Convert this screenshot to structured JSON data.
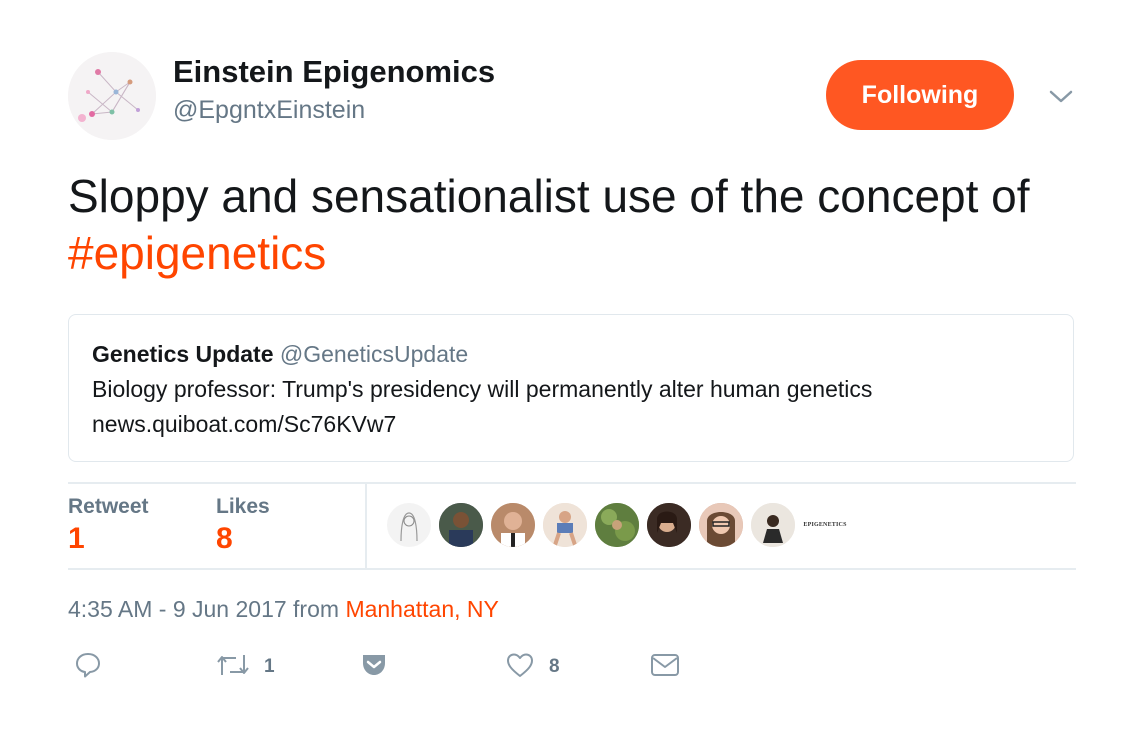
{
  "colors": {
    "accent": "#ff4500",
    "follow_button": "#ff5722",
    "muted_text": "#657786"
  },
  "author": {
    "display_name": "Einstein Epigenomics",
    "handle": "@EpgntxEinstein",
    "avatar_icon": "network-diagram-avatar"
  },
  "follow_button": {
    "label": "Following"
  },
  "caret_icon": "chevron-down-icon",
  "tweet": {
    "text_before": "Sloppy and sensationalist use of the concept of ",
    "hashtag": "#epigenetics"
  },
  "quoted_tweet": {
    "name": "Genetics Update",
    "handle": "@GeneticsUpdate",
    "text": "Biology professor: Trump's presidency will permanently alter human genetics",
    "link": "news.quiboat.com/Sc76KVw7"
  },
  "stats": {
    "retweet_label": "Retweet",
    "retweet_count": "1",
    "likes_label": "Likes",
    "likes_count": "8"
  },
  "likers_logo_text": "EPIGENETICS",
  "timestamp": {
    "text": "4:35 AM - 9 Jun 2017 from ",
    "location": "Manhattan, NY"
  },
  "actions": {
    "reply_icon": "reply-icon",
    "retweet_icon": "retweet-icon",
    "retweet_count": "1",
    "save_icon": "pocket-icon",
    "like_icon": "heart-icon",
    "like_count": "8",
    "message_icon": "envelope-icon"
  }
}
